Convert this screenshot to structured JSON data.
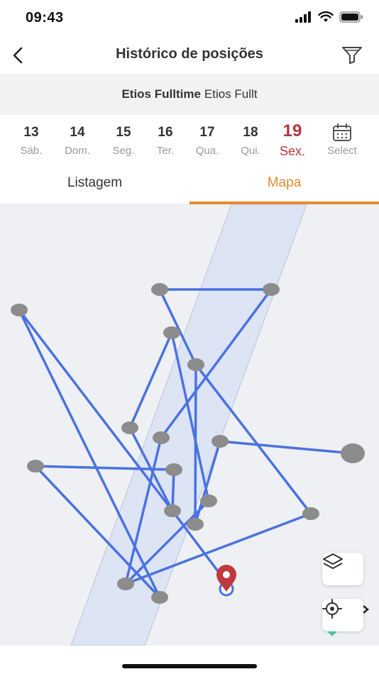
{
  "status": {
    "time": "09:43"
  },
  "header": {
    "title": "Histórico de posições",
    "back_icon": "chevron-left-icon",
    "filter_icon": "funnel-icon"
  },
  "vehicle": {
    "name_bold": "Etios Fulltime",
    "name": "Etios Fullt"
  },
  "dates": [
    {
      "num": "13",
      "day": "Sáb."
    },
    {
      "num": "14",
      "day": "Dom."
    },
    {
      "num": "15",
      "day": "Seg."
    },
    {
      "num": "16",
      "day": "Ter."
    },
    {
      "num": "17",
      "day": "Qua."
    },
    {
      "num": "18",
      "day": "Qui."
    },
    {
      "num": "19",
      "day": "Sex.",
      "selected": true
    },
    {
      "icon": "calendar-icon",
      "day": "Select"
    }
  ],
  "tabs": [
    {
      "label": "Listagem",
      "active": false
    },
    {
      "label": "Mapa",
      "active": true
    }
  ],
  "map": {
    "route_color": "#4a72e0",
    "point_color": "#8c8c8c",
    "pin_color": "#c0393f",
    "buttons": [
      "layers-icon",
      "my-location-icon"
    ]
  },
  "colors": {
    "accent": "#e88a32",
    "selected_day": "#b5353c"
  }
}
